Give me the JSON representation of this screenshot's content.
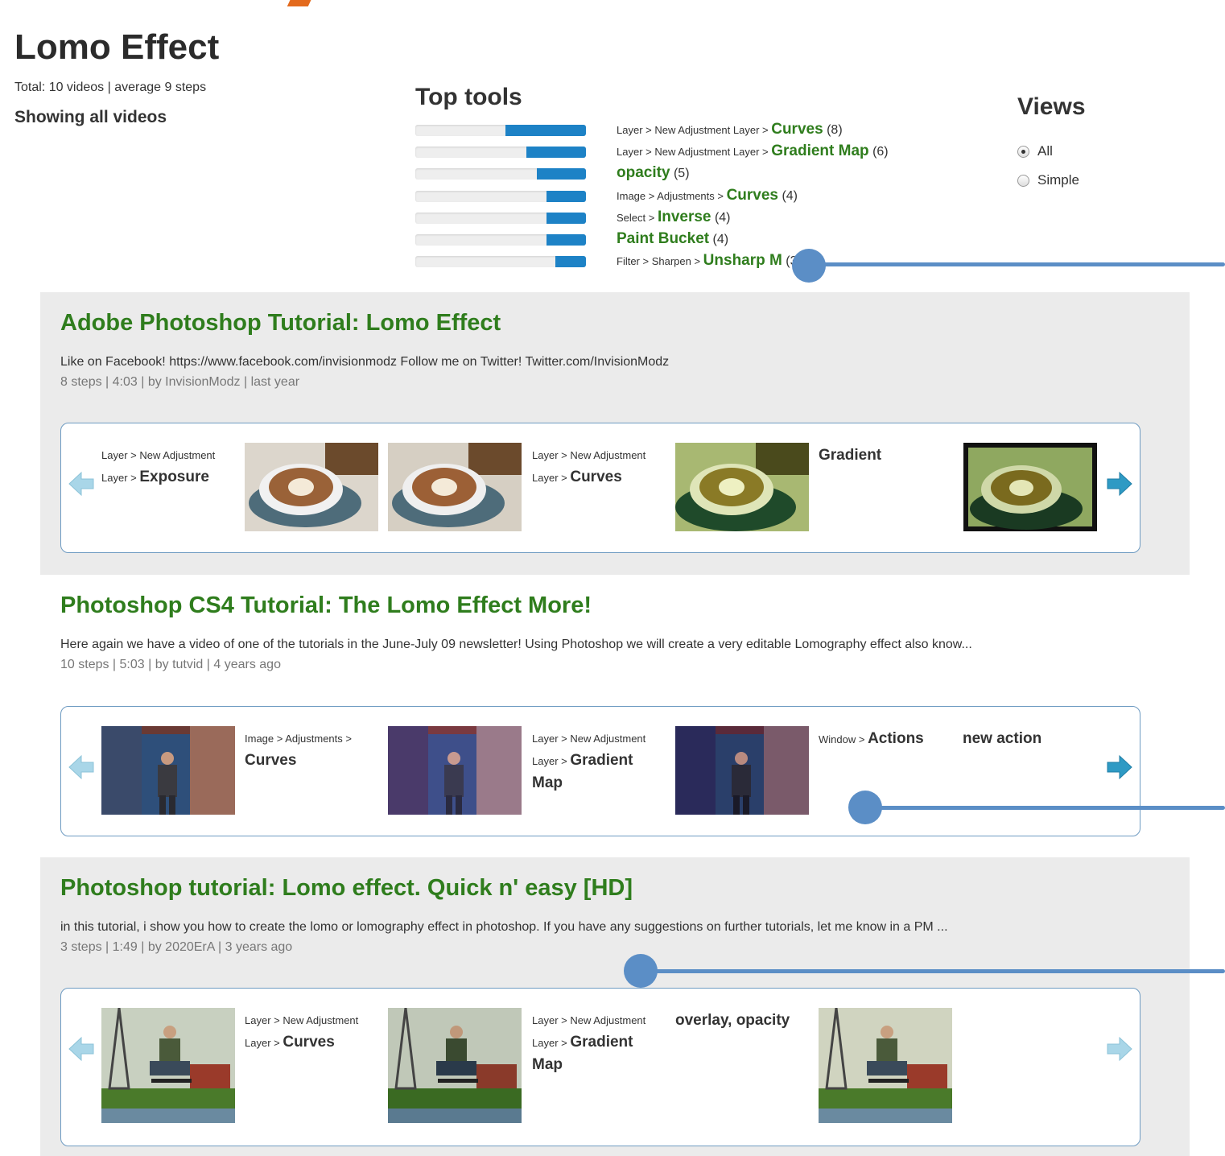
{
  "header": {
    "title": "Lomo Effect",
    "stats": "Total: 10 videos | average 9 steps",
    "showing": "Showing all videos"
  },
  "top_tools": {
    "title": "Top tools",
    "items": [
      {
        "path": "Layer > New Adjustment Layer > ",
        "name": "Curves",
        "count": " (8)",
        "fill": 0.47
      },
      {
        "path": "Layer > New Adjustment Layer > ",
        "name": "Gradient Map",
        "count": " (6)",
        "fill": 0.35
      },
      {
        "path": "",
        "name": "opacity",
        "count": " (5)",
        "fill": 0.29
      },
      {
        "path": "Image > Adjustments > ",
        "name": "Curves",
        "count": " (4)",
        "fill": 0.23
      },
      {
        "path": "Select > ",
        "name": "Inverse",
        "count": " (4)",
        "fill": 0.23
      },
      {
        "path": "",
        "name": "Paint Bucket",
        "count": " (4)",
        "fill": 0.23
      },
      {
        "path": "Filter > Sharpen > ",
        "name": "Unsharp M",
        "count": " (3)",
        "fill": 0.18
      }
    ]
  },
  "views": {
    "title": "Views",
    "options": [
      {
        "label": "All",
        "selected": true
      },
      {
        "label": "Simple",
        "selected": false
      }
    ]
  },
  "videos": [
    {
      "title": "Adobe Photoshop Tutorial: Lomo Effect",
      "description": "Like on Facebook! https://www.facebook.com/invisionmodz Follow me on Twitter! Twitter.com/InvisionModz",
      "meta": "8 steps | 4:03 | by InvisionModz | last year",
      "steps": [
        {
          "line1": "Layer > New Adjustment",
          "line2_path": "Layer > ",
          "name": "Exposure"
        },
        {
          "line1": "Layer > New Adjustment",
          "line2_path": "Layer > ",
          "name": "Curves"
        },
        {
          "name": "Gradient"
        }
      ]
    },
    {
      "title": "Photoshop CS4 Tutorial: The Lomo Effect More!",
      "description": "Here again we have a video of one of the tutorials in the June-July 09 newsletter! Using Photoshop we will create a very editable Lomography effect also know...",
      "meta": "10 steps | 5:03 | by tutvid | 4 years ago",
      "steps": [
        {
          "line1": "Image > Adjustments >",
          "name": "Curves"
        },
        {
          "line1": "Layer > New Adjustment",
          "line2_path": "Layer > ",
          "name": "Gradient",
          "name2": "Map"
        },
        {
          "line1_path": "Window > ",
          "name": "Actions"
        },
        {
          "name": "new action"
        }
      ]
    },
    {
      "title": "Photoshop tutorial: Lomo effect. Quick n' easy [HD]",
      "description": "in this tutorial, i show you how to create the lomo or lomography effect in photoshop. If you have any suggestions on further tutorials, let me know in a PM ...",
      "meta": "3 steps | 1:49 | by 2020ErA | 3 years ago",
      "steps": [
        {
          "line1": "Layer > New Adjustment",
          "line2_path": "Layer > ",
          "name": "Curves"
        },
        {
          "line1": "Layer > New Adjustment",
          "line2_path": "Layer > ",
          "name": "Gradient",
          "name2": "Map"
        },
        {
          "name": "overlay, opacity"
        }
      ]
    }
  ],
  "icons": {
    "prev": "prev-arrow-icon",
    "next": "next-arrow-icon",
    "callout": "callout-pointer"
  },
  "colors": {
    "accent": "#2f7d1d",
    "bar": "#1d82c6",
    "callout": "#5b8ec6",
    "border": "#6e9bc2"
  }
}
